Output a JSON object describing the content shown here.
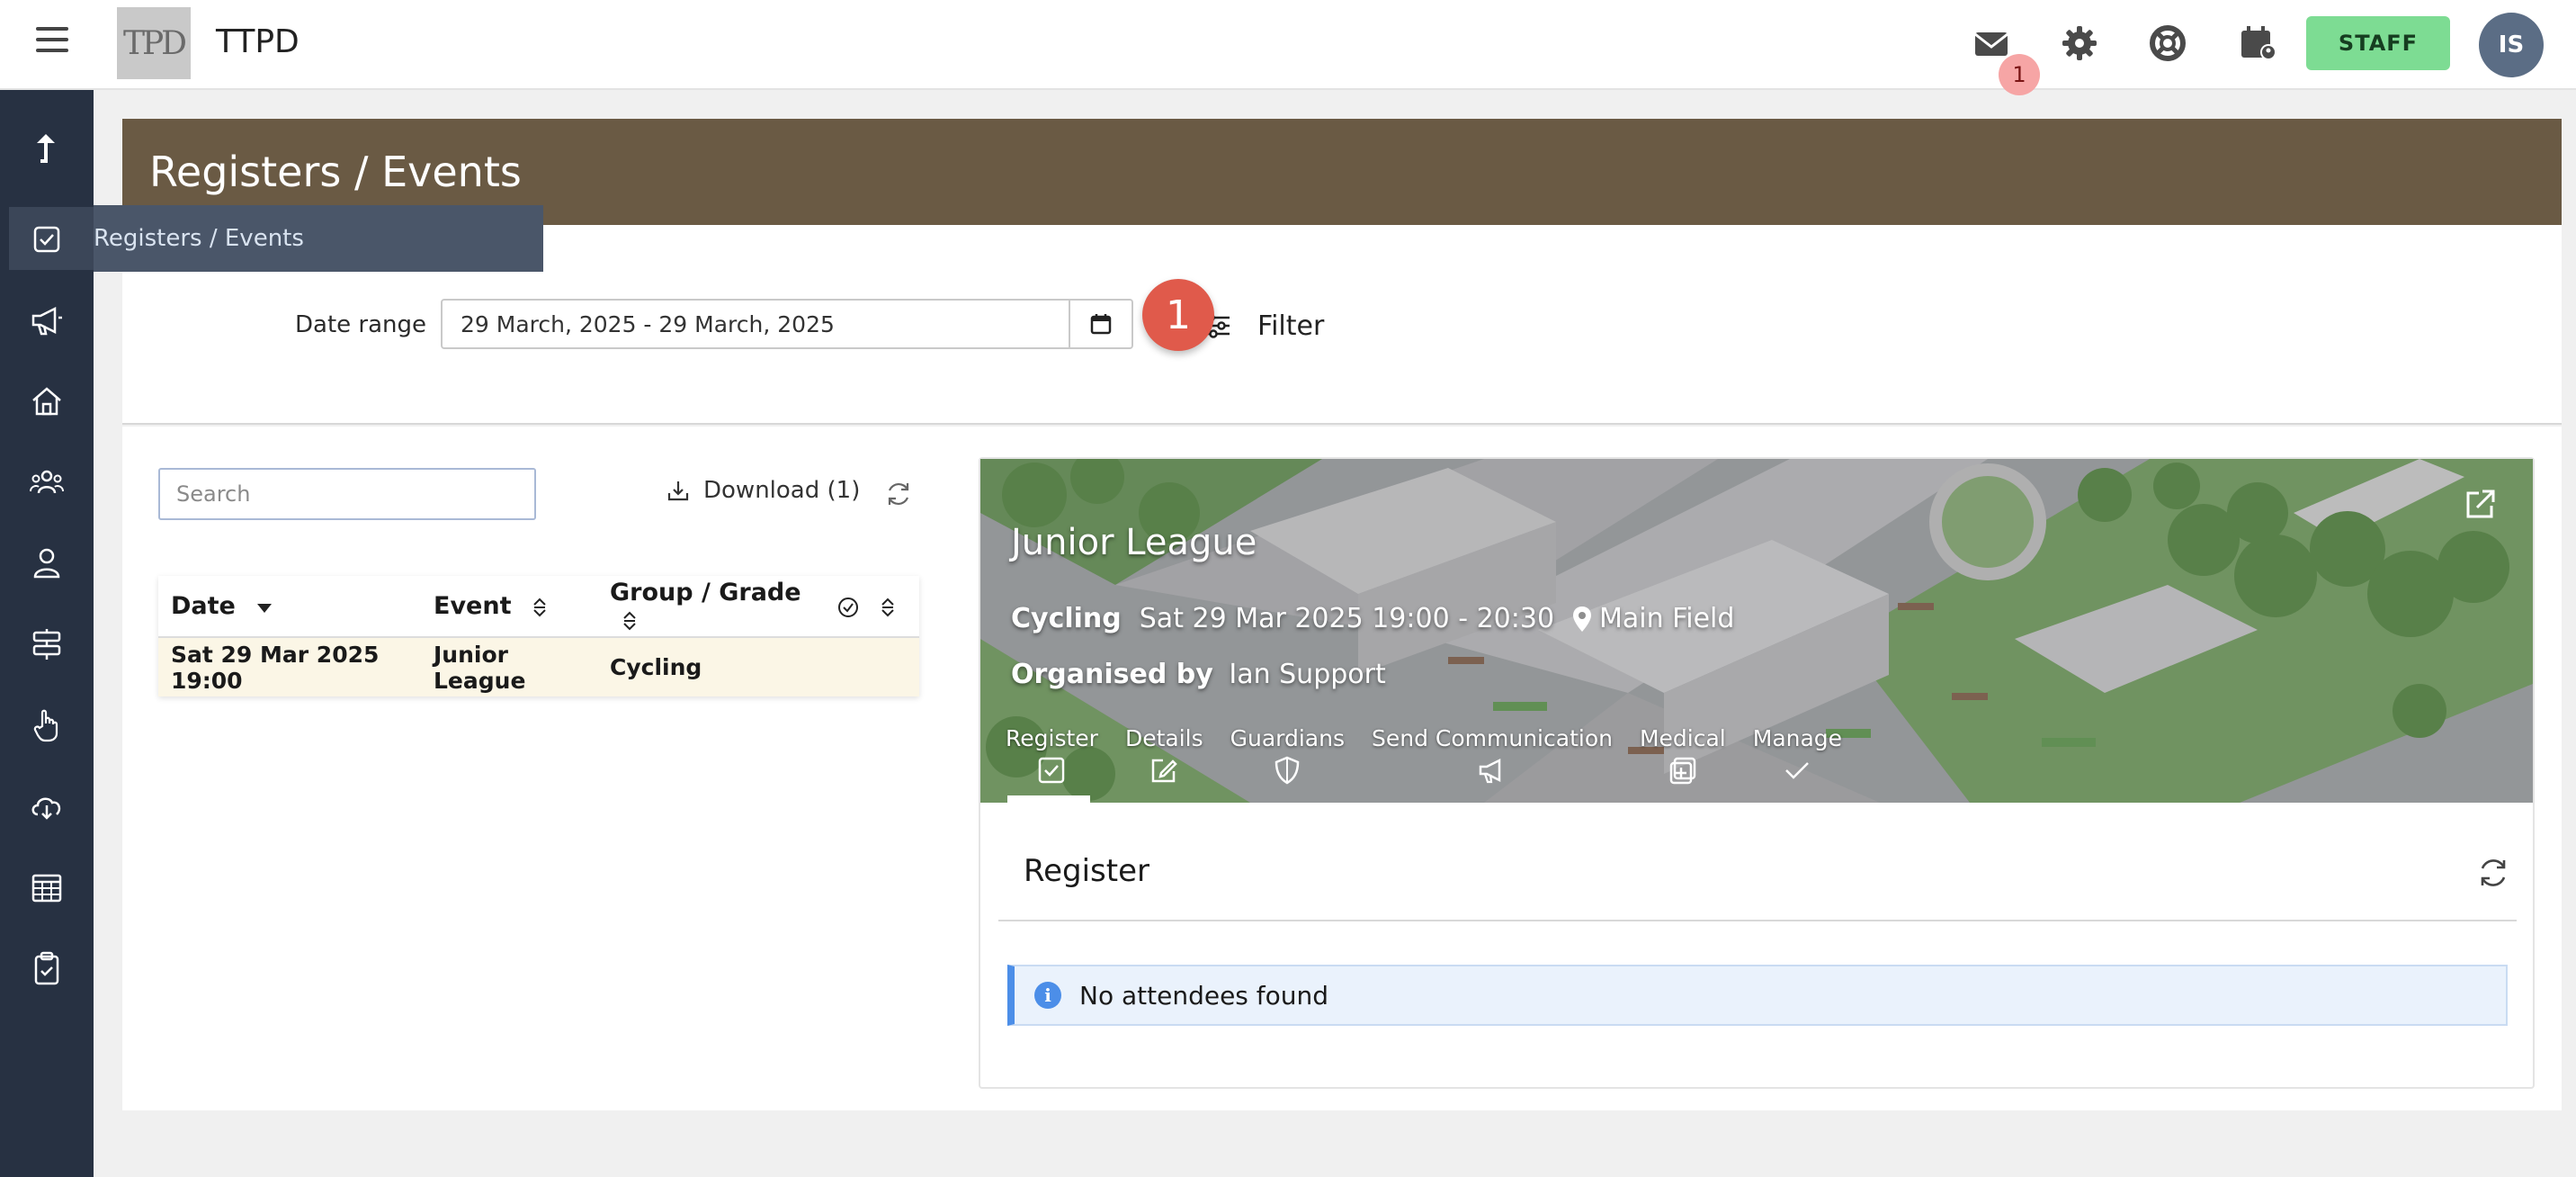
{
  "app": {
    "title": "TTPD",
    "logo_text": "TPD"
  },
  "header": {
    "mail_badge_count": "1",
    "staff_label": "STAFF",
    "avatar_initials": "IS"
  },
  "sidebar": {
    "tooltip": "Registers / Events",
    "items": [
      {
        "icon": "level-up-icon"
      },
      {
        "icon": "checkbox-icon"
      },
      {
        "icon": "megaphone-icon"
      },
      {
        "icon": "home-icon"
      },
      {
        "icon": "people-icon"
      },
      {
        "icon": "person-icon"
      },
      {
        "icon": "signpost-icon"
      },
      {
        "icon": "hand-pointer-icon"
      },
      {
        "icon": "cloud-download-icon"
      },
      {
        "icon": "table-icon"
      },
      {
        "icon": "clipboard-check-icon"
      }
    ]
  },
  "page": {
    "title": "Registers / Events"
  },
  "filter": {
    "date_label": "Date range",
    "date_value": "29 March, 2025 - 29 March, 2025",
    "badge": "1",
    "filter_label": "Filter"
  },
  "list": {
    "search_placeholder": "Search",
    "download_label": "Download (1)",
    "columns": [
      "Date",
      "Event",
      "Group / Grade"
    ],
    "rows": [
      {
        "date": "Sat 29 Mar 2025 19:00",
        "event": "Junior League",
        "group": "Cycling"
      }
    ]
  },
  "event": {
    "title": "Junior League",
    "activity": "Cycling",
    "datetime": "Sat 29 Mar 2025 19:00 - 20:30",
    "location": "Main Field",
    "organised_prefix": "Organised by",
    "organiser": "Ian Support",
    "tabs": [
      "Register",
      "Details",
      "Guardians",
      "Send Communication",
      "Medical",
      "Manage"
    ],
    "active_tab": "Register"
  },
  "register": {
    "heading": "Register",
    "empty_message": "No attendees found"
  }
}
